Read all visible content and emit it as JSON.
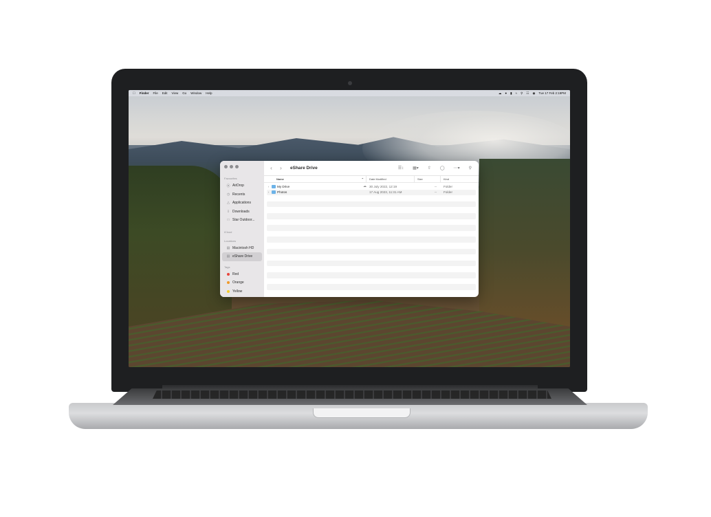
{
  "menubar": {
    "apple": "",
    "items": [
      "Finder",
      "File",
      "Edit",
      "View",
      "Go",
      "Window",
      "Help"
    ],
    "clock": "Tue 17 Feb 2:19PM"
  },
  "finder": {
    "title": "eShare Drive",
    "sidebar": {
      "favourites_label": "Favourites",
      "favourites": [
        {
          "label": "AirDrop",
          "icon": "airdrop-icon"
        },
        {
          "label": "Recents",
          "icon": "clock-icon"
        },
        {
          "label": "Applications",
          "icon": "applications-icon"
        },
        {
          "label": "Downloads",
          "icon": "download-icon"
        },
        {
          "label": "Star Outdoor...",
          "icon": "folder-icon"
        }
      ],
      "icloud_label": "iCloud",
      "locations_label": "Locations",
      "locations": [
        {
          "label": "Macintosh HD",
          "icon": "disk-icon"
        },
        {
          "label": "eShare Drive",
          "icon": "cloud-drive-icon",
          "selected": true
        }
      ],
      "tags_label": "Tags",
      "tags": [
        {
          "label": "Red",
          "color": "#e8453c"
        },
        {
          "label": "Orange",
          "color": "#f19a2a"
        },
        {
          "label": "Yellow",
          "color": "#f4cc2b"
        }
      ]
    },
    "columns": {
      "name": "Name",
      "date": "Date Modified",
      "size": "Size",
      "kind": "Kind"
    },
    "rows": [
      {
        "name": "My Drive",
        "date": "30 July 2022, 12:19",
        "size": "--",
        "kind": "Folder"
      },
      {
        "name": "Photos",
        "date": "17 Aug 2023, 11:31 AM",
        "size": "--",
        "kind": "Folder"
      }
    ]
  }
}
